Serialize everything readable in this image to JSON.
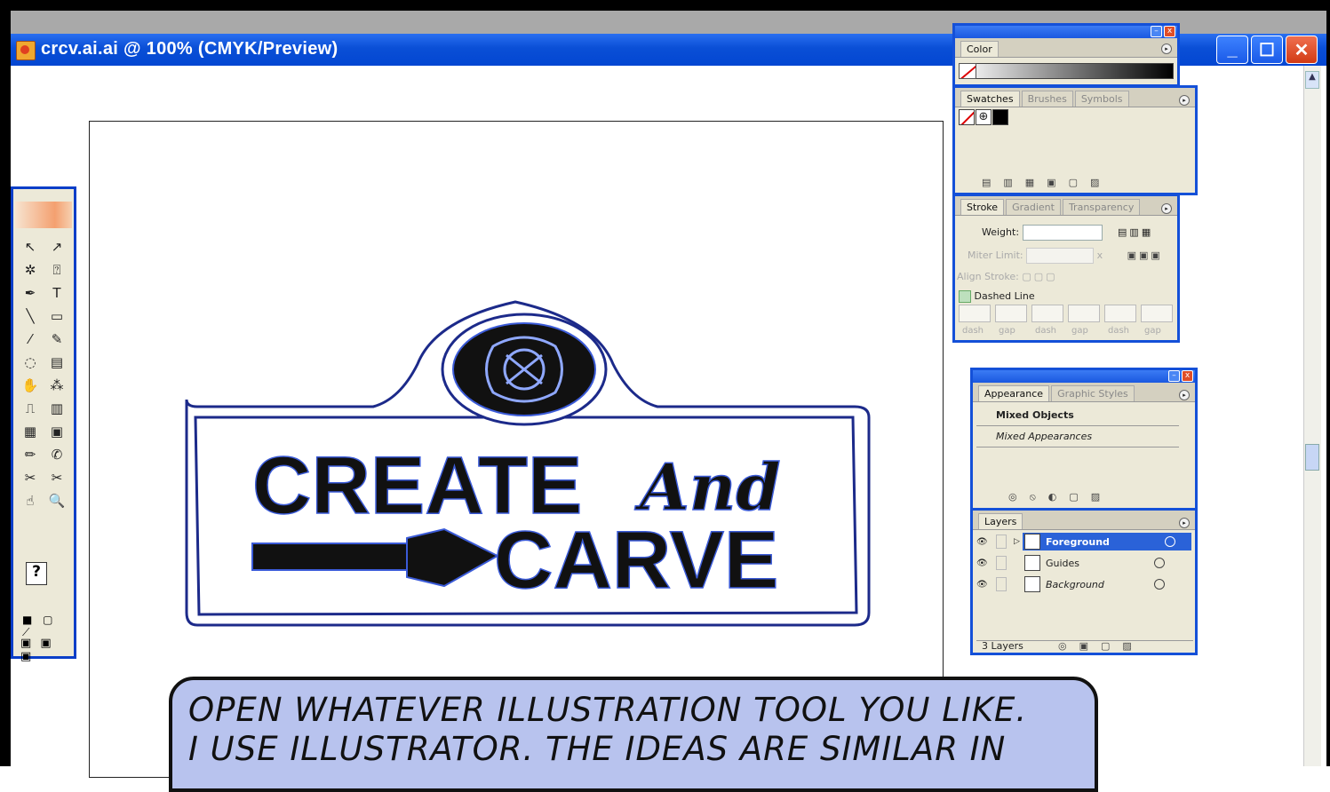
{
  "window": {
    "title": "crcv.ai.ai @ 100% (CMYK/Preview)",
    "buttons": {
      "minimize": "_",
      "maximize": "☐",
      "close": "✕"
    }
  },
  "artwork": {
    "line1_word1": "CREATE",
    "line1_word2": "And",
    "line2": "CARVE"
  },
  "toolbox": {
    "tools": [
      "↖",
      "↗",
      "✲",
      "⍰",
      "✒",
      "T",
      "╲",
      "▭",
      "⁄",
      "✎",
      "◌",
      "▤",
      "✋",
      "⁂",
      "⎍",
      "▥",
      "▦",
      "▣",
      "✏",
      "✆",
      "✂",
      "✂",
      "☝",
      "🔍"
    ],
    "help": "?",
    "swatch_row": "■ ▢ ⟋",
    "mode_row": "▣ ▣ ▣"
  },
  "panels": {
    "color": {
      "tab": "Color"
    },
    "swatches": {
      "tabs": [
        "Swatches",
        "Brushes",
        "Symbols"
      ]
    },
    "stroke": {
      "tabs": [
        "Stroke",
        "Gradient",
        "Transparency"
      ],
      "weight_label": "Weight:",
      "miter_label": "Miter Limit:",
      "miter_unit": "x",
      "align_label": "Align Stroke:",
      "dashed_label": "Dashed Line",
      "dash_labels": [
        "dash",
        "gap",
        "dash",
        "gap",
        "dash",
        "gap"
      ]
    },
    "appearance": {
      "tabs": [
        "Appearance",
        "Graphic Styles"
      ],
      "item1": "Mixed Objects",
      "item2": "Mixed Appearances"
    },
    "layers": {
      "tab": "Layers",
      "rows": [
        {
          "name": "Foreground"
        },
        {
          "name": "Guides"
        },
        {
          "name": "Background"
        }
      ],
      "count": "3 Layers"
    }
  },
  "caption": {
    "line1": "OPEN WHATEVER ILLUSTRATION TOOL YOU LIKE.",
    "line2": "I USE ILLUSTRATOR. THE IDEAS ARE SIMILAR IN"
  },
  "colors": {
    "title_blue": "#0a4fd6",
    "panel_border": "#1450d8",
    "caption_bg": "#b8c3ee",
    "path_blue": "#3b5bd8"
  }
}
